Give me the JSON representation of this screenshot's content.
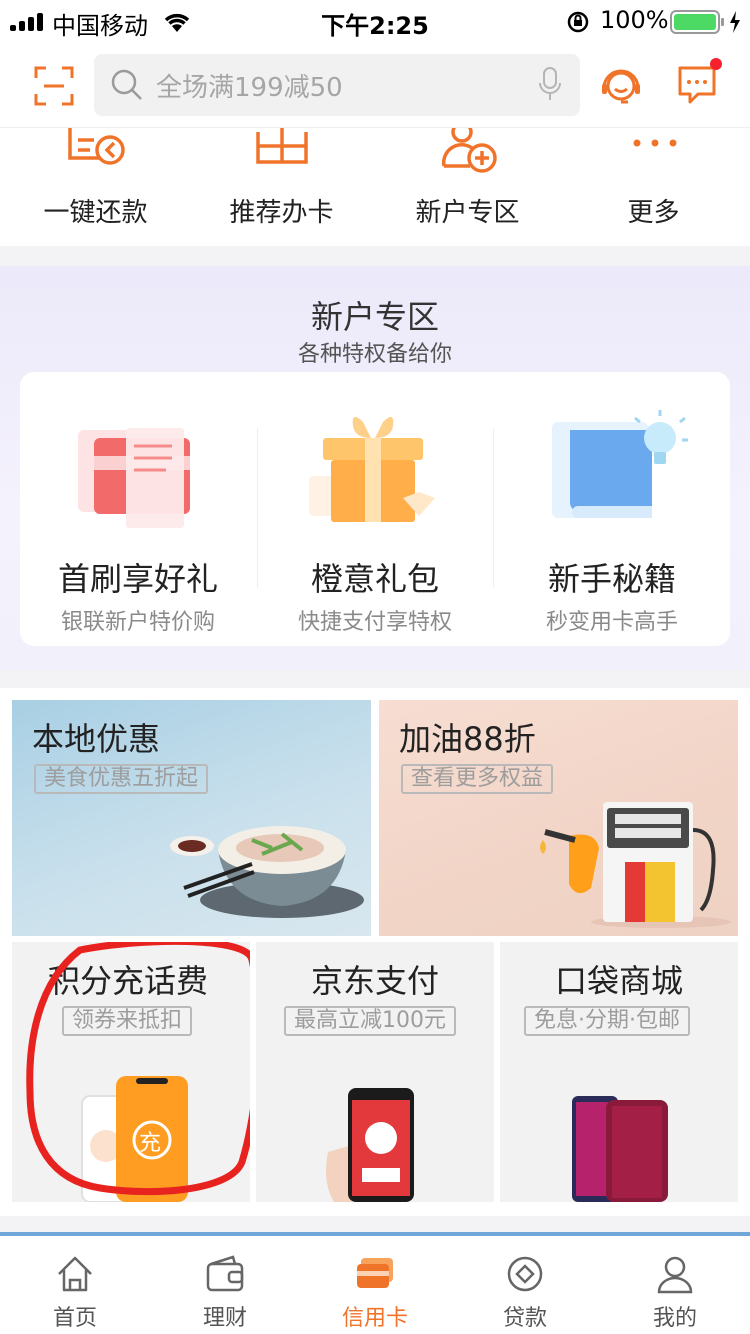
{
  "status_bar": {
    "carrier": "中国移动",
    "time": "下午2:25",
    "battery": "100%"
  },
  "header": {
    "search_placeholder": "全场满199减50"
  },
  "quick_nav": [
    {
      "label": "一键还款",
      "icon": "repay-icon"
    },
    {
      "label": "推荐办卡",
      "icon": "gift-card-icon"
    },
    {
      "label": "新户专区",
      "icon": "new-user-icon"
    },
    {
      "label": "更多",
      "icon": "more-icon"
    }
  ],
  "new_user_zone": {
    "title": "新户专区",
    "subtitle": "各种特权备给你",
    "items": [
      {
        "title": "首刷享好礼",
        "subtitle": "银联新户特价购",
        "icon": "card-gift-icon"
      },
      {
        "title": "橙意礼包",
        "subtitle": "快捷支付享特权",
        "icon": "gift-box-icon"
      },
      {
        "title": "新手秘籍",
        "subtitle": "秒变用卡高手",
        "icon": "guide-book-icon"
      }
    ]
  },
  "promos": {
    "local": {
      "title": "本地优惠",
      "tag": "美食优惠五折起"
    },
    "fuel": {
      "title": "加油88折",
      "tag": "查看更多权益"
    },
    "points": {
      "title": "积分充话费",
      "tag": "领券来抵扣",
      "badge": "充"
    },
    "jd": {
      "title": "京东支付",
      "tag": "最高立减100元"
    },
    "mall": {
      "title": "口袋商城",
      "tag": "免息·分期·包邮"
    }
  },
  "tab_bar": [
    {
      "label": "首页",
      "active": false
    },
    {
      "label": "理财",
      "active": false
    },
    {
      "label": "信用卡",
      "active": true
    },
    {
      "label": "贷款",
      "active": false
    },
    {
      "label": "我的",
      "active": false
    }
  ],
  "colors": {
    "accent": "#f0732a",
    "annotation_red": "#e8231f"
  }
}
